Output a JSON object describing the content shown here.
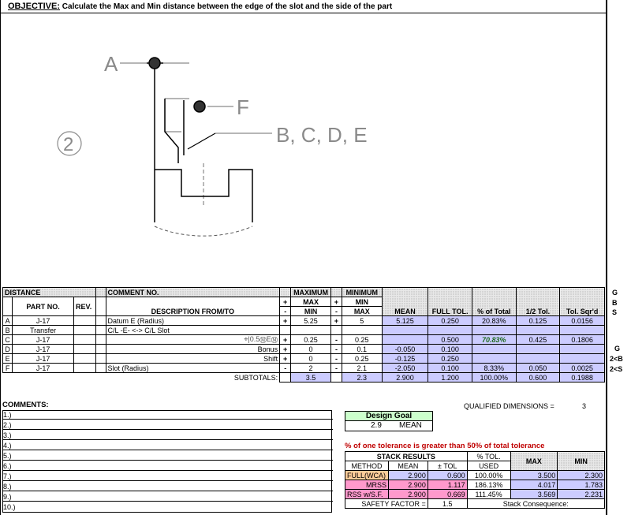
{
  "objective": {
    "label": "OBJECTIVE:",
    "text": "Calculate the Max and Min distance between the edge of the slot and the side of the part"
  },
  "drawing": {
    "circled_num": "2",
    "label_a": "A",
    "label_f": "F",
    "label_bcde": "B, C, D, E"
  },
  "headers": {
    "distance": "DISTANCE",
    "comment_no": "COMMENT NO.",
    "part_no": "PART NO.",
    "rev": "REV.",
    "description": "DESCRIPTION FROM/TO",
    "maximum": "MAXIMUM",
    "minimum": "MINIMUM",
    "max_min": "MAX",
    "max_min2": "MIN",
    "min_max": "MIN",
    "min_max2": "MAX",
    "mean": "MEAN",
    "full_tol": "FULL TOL.",
    "pct_total": "% of Total",
    "half_tol": "1/2 Tol.",
    "tol_sqrd": "Tol. Sqr'd",
    "plus": "+",
    "minus": "-"
  },
  "side_letters": [
    "G",
    "B",
    "S"
  ],
  "rows": [
    {
      "id": "A",
      "part": "J-17",
      "desc": "Datum E (Radius)",
      "sign1": "+",
      "max": "5.25",
      "sign2": "+",
      "min": "5",
      "mean": "5.125",
      "full_tol": "0.250",
      "pct": "20.83%",
      "half": "0.125",
      "sqr": "0.0156",
      "side": ""
    },
    {
      "id": "B",
      "part": "Transfer",
      "desc": "C/L -E- <-> C/L Slot",
      "sign1": "",
      "max": "",
      "sign2": "",
      "min": "",
      "mean": "",
      "full_tol": "",
      "pct": "",
      "half": "",
      "sqr": "",
      "side": ""
    },
    {
      "id": "C",
      "part": "J-17",
      "desc": "⌖|0.5ⓂEⓂ",
      "sign1": "+",
      "max": "0.25",
      "sign2": "-",
      "min": "0.25",
      "mean": "",
      "full_tol": "0.500",
      "pct": "70.83%",
      "half": "0.425",
      "sqr": "0.1806",
      "side": "G"
    },
    {
      "id": "D",
      "part": "J-17",
      "desc": "Bonus",
      "sign1": "+",
      "max": "0",
      "sign2": "-",
      "min": "0.1",
      "mean": "-0.050",
      "full_tol": "0.100",
      "pct": "",
      "half": "",
      "sqr": "",
      "side": "2<B"
    },
    {
      "id": "E",
      "part": "J-17",
      "desc": "Shift",
      "sign1": "+",
      "max": "0",
      "sign2": "-",
      "min": "0.25",
      "mean": "-0.125",
      "full_tol": "0.250",
      "pct": "",
      "half": "",
      "sqr": "",
      "side": "2<S"
    },
    {
      "id": "F",
      "part": "J-17",
      "desc": "Slot (Radius)",
      "sign1": "-",
      "max": "2",
      "sign2": "-",
      "min": "2.1",
      "mean": "-2.050",
      "full_tol": "0.100",
      "pct": "8.33%",
      "half": "0.050",
      "sqr": "0.0025",
      "side": ""
    }
  ],
  "subtotals": {
    "label": "SUBTOTALS:",
    "max": "3.5",
    "min": "2.3",
    "mean": "2.900",
    "full_tol": "1.200",
    "pct": "100.00%",
    "half": "0.600",
    "sqr": "0.1988"
  },
  "qualified": {
    "label": "QUALIFIED DIMENSIONS =",
    "value": "3"
  },
  "comments": {
    "title": "COMMENTS:",
    "items": [
      "1.)",
      "2.)",
      "3.)",
      "4.)",
      "5.)",
      "6.)",
      "7.)",
      "8.)",
      "9.)",
      "10.)"
    ]
  },
  "design_goal": {
    "title": "Design Goal",
    "value": "2.9",
    "label": "MEAN"
  },
  "warning": "% of one tolerance is greater than 50% of total tolerance",
  "stack": {
    "title": "STACK RESULTS",
    "pct_tol": "% TOL.",
    "used": "USED",
    "max": "MAX",
    "min": "MIN",
    "col_method": "METHOD",
    "col_mean": "MEAN",
    "col_tol": "± TOL",
    "rows": [
      {
        "method": "FULL(WCA)",
        "mean": "2.900",
        "tol": "0.600",
        "used": "100.00%",
        "max": "3.500",
        "min": "2.300"
      },
      {
        "method": "MRSS",
        "mean": "2.900",
        "tol": "1.117",
        "used": "186.13%",
        "max": "4.017",
        "min": "1.783"
      },
      {
        "method": "RSS w/S.F.",
        "mean": "2.900",
        "tol": "0.669",
        "used": "111.45%",
        "max": "3.569",
        "min": "2.231"
      }
    ],
    "safety_label": "SAFETY FACTOR =",
    "safety_value": "1.5",
    "consequence": "Stack Consequence:"
  }
}
